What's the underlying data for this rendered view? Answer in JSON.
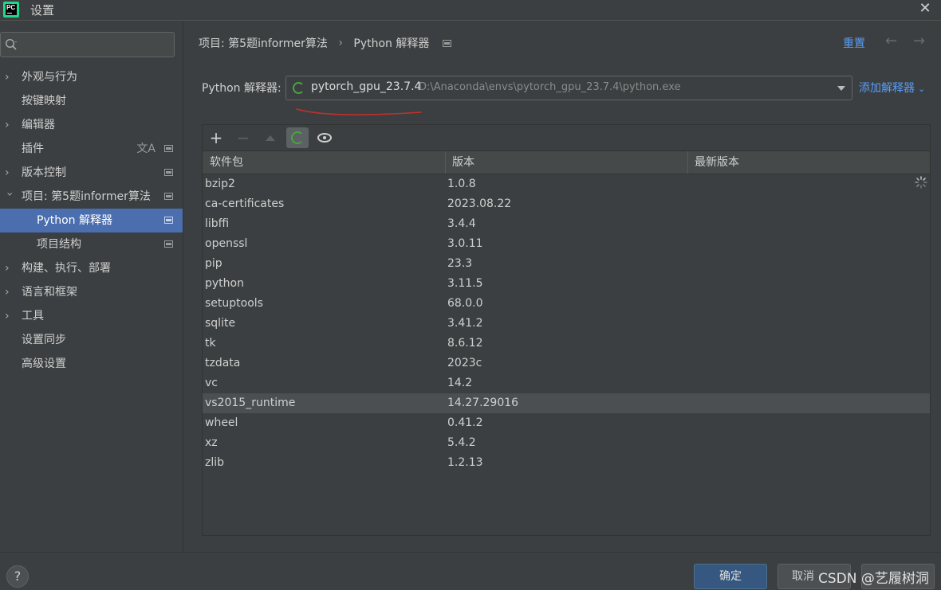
{
  "window": {
    "title": "设置",
    "logo_text": "PC"
  },
  "search": {
    "placeholder": "",
    "value": ""
  },
  "sidebar": {
    "items": [
      {
        "label": "外观与行为",
        "expandable": true
      },
      {
        "label": "按键映射",
        "expandable": false
      },
      {
        "label": "编辑器",
        "expandable": true
      },
      {
        "label": "插件",
        "expandable": false,
        "translate_icon": "文A"
      },
      {
        "label": "版本控制",
        "expandable": true
      },
      {
        "label": "项目: 第5题informer算法",
        "expandable": true,
        "expanded": true
      },
      {
        "label": "Python 解释器",
        "selected": true
      },
      {
        "label": "项目结构"
      },
      {
        "label": "构建、执行、部署",
        "expandable": true
      },
      {
        "label": "语言和框架",
        "expandable": true
      },
      {
        "label": "工具",
        "expandable": true
      },
      {
        "label": "设置同步",
        "expandable": false
      },
      {
        "label": "高级设置",
        "expandable": false
      }
    ]
  },
  "breadcrumb": {
    "project": "项目: 第5题informer算法",
    "separator": "›",
    "page": "Python 解释器"
  },
  "header": {
    "reset": "重置",
    "back": "←",
    "forward": "→"
  },
  "interpreter": {
    "label": "Python 解释器:",
    "name": "pytorch_gpu_23.7.4",
    "path": "D:\\Anaconda\\envs\\pytorch_gpu_23.7.4\\python.exe",
    "add_label": "添加解释器",
    "add_caret": "⌄"
  },
  "toolbar": {
    "add": "+",
    "remove": "−"
  },
  "table": {
    "headers": [
      "软件包",
      "版本",
      "最新版本"
    ],
    "rows": [
      [
        "bzip2",
        "1.0.8",
        ""
      ],
      [
        "ca-certificates",
        "2023.08.22",
        ""
      ],
      [
        "libffi",
        "3.4.4",
        ""
      ],
      [
        "openssl",
        "3.0.11",
        ""
      ],
      [
        "pip",
        "23.3",
        ""
      ],
      [
        "python",
        "3.11.5",
        ""
      ],
      [
        "setuptools",
        "68.0.0",
        ""
      ],
      [
        "sqlite",
        "3.41.2",
        ""
      ],
      [
        "tk",
        "8.6.12",
        ""
      ],
      [
        "tzdata",
        "2023c",
        ""
      ],
      [
        "vc",
        "14.2",
        ""
      ],
      [
        "vs2015_runtime",
        "14.27.29016",
        ""
      ],
      [
        "wheel",
        "0.41.2",
        ""
      ],
      [
        "xz",
        "5.4.2",
        ""
      ],
      [
        "zlib",
        "1.2.13",
        ""
      ]
    ],
    "highlighted_row": "vs2015_runtime"
  },
  "footer": {
    "help": "?",
    "ok": "确定",
    "cancel": "取消",
    "apply": "",
    "watermark": "CSDN @艺履树洞"
  },
  "colors": {
    "accent": "#589df6",
    "selection": "#4b6eaf",
    "ok_button": "#365880",
    "spinner": "#49a43f",
    "annotation": "#c2302c"
  }
}
